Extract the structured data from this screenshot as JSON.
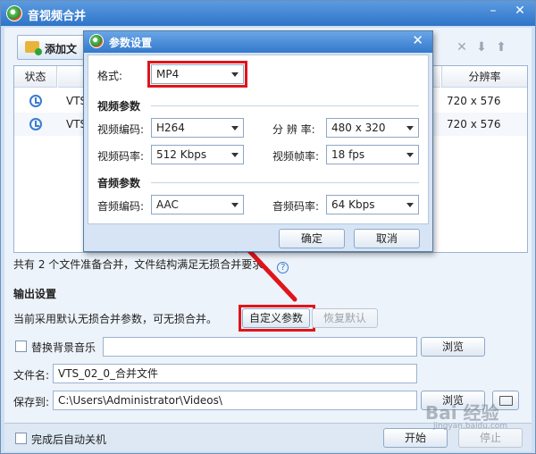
{
  "main_window": {
    "title": "音视频合并",
    "minimize_glyph": "–",
    "close_glyph": "✕",
    "add_button_label": "添加文",
    "toolbar_icons": [
      "delete-icon",
      "move-down-icon",
      "move-up-icon"
    ],
    "table": {
      "columns": [
        "状态",
        "分辨率"
      ],
      "rows": [
        {
          "name": "VTS",
          "resolution": "720 x 576"
        },
        {
          "name": "VTS",
          "resolution": "720 x 576"
        }
      ]
    },
    "summary_text": "共有 2 个文件准备合并，文件结构满足无损合并要求。",
    "help_glyph": "?",
    "output_section_title": "输出设置",
    "current_note": "当前采用默认无损合并参数，可无损合并。",
    "custom_params_label": "自定义参数",
    "restore_default_label": "恢复默认",
    "bg_music_label": "替换背景音乐",
    "browse_label_1": "浏览",
    "filename_label": "文件名:",
    "filename_value": "VTS_02_0_合并文件",
    "saveto_label": "保存到:",
    "saveto_value": "C:\\Users\\Administrator\\Videos\\",
    "browse_label_2": "浏览",
    "auto_shutdown_label": "完成后自动关机",
    "start_label": "开始",
    "stop_label": "停止"
  },
  "dialog": {
    "title": "参数设置",
    "close_glyph": "✕",
    "format_label": "格式:",
    "format_value": "MP4",
    "video_section": "视频参数",
    "video_codec_label": "视频编码:",
    "video_codec_value": "H264",
    "resolution_label": "分 辨 率:",
    "resolution_value": "480 x 320",
    "video_bitrate_label": "视频码率:",
    "video_bitrate_value": "512 Kbps",
    "framerate_label": "视频帧率:",
    "framerate_value": "18 fps",
    "audio_section": "音频参数",
    "audio_codec_label": "音频编码:",
    "audio_codec_value": "AAC",
    "audio_bitrate_label": "音频码率:",
    "audio_bitrate_value": "64 Kbps",
    "ok_label": "确定",
    "cancel_label": "取消"
  },
  "watermark": {
    "text": "Bai 经验",
    "sub": "jingyan.baidu.com"
  },
  "colors": {
    "highlight": "#e0151b",
    "title_bar": "#2f74c8",
    "accent_blue": "#3a7cd0"
  }
}
